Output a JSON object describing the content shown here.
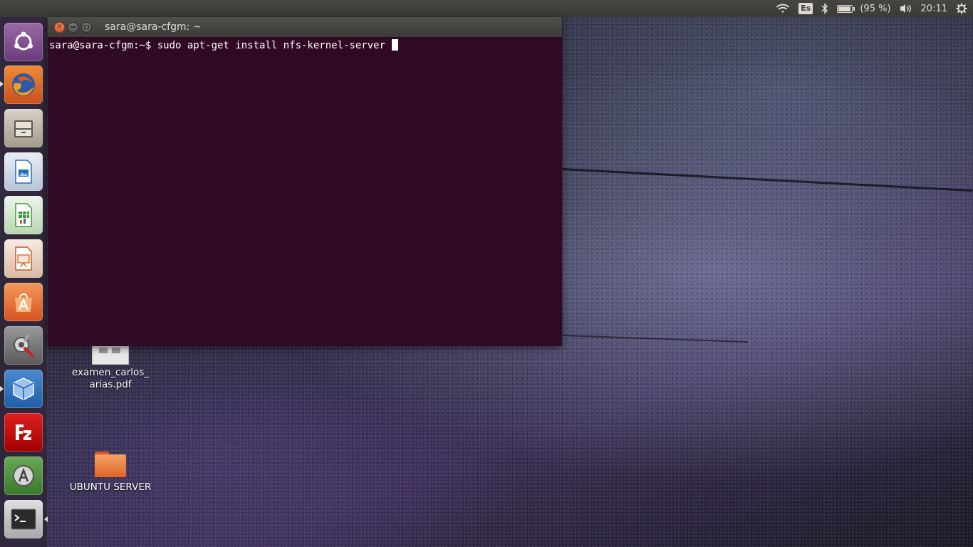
{
  "top_panel": {
    "keyboard_layout": "Es",
    "battery_level": 0.95,
    "battery_text": "(95 %)",
    "clock": "20:11",
    "icons": [
      "wifi-icon",
      "bluetooth-icon",
      "battery-icon",
      "volume-icon",
      "settings-gear-icon"
    ]
  },
  "launcher": {
    "items": [
      {
        "name": "ubuntu-dash-icon",
        "color": "#7a4a8c"
      },
      {
        "name": "firefox-icon",
        "color": "#e66000"
      },
      {
        "name": "files-icon",
        "color": "#8a7d6a"
      },
      {
        "name": "libreoffice-writer-icon",
        "color": "#2a6db0"
      },
      {
        "name": "libreoffice-calc-icon",
        "color": "#3f9a3a"
      },
      {
        "name": "libreoffice-impress-icon",
        "color": "#c85a23"
      },
      {
        "name": "ubuntu-software-center-icon",
        "color": "#e9682a"
      },
      {
        "name": "system-settings-icon",
        "color": "#6a6a6a"
      },
      {
        "name": "virtualbox-icon",
        "color": "#1f5fa6"
      },
      {
        "name": "filezilla-icon",
        "color": "#bf0000"
      },
      {
        "name": "software-updater-icon",
        "color": "#4a8a3a"
      },
      {
        "name": "terminal-icon",
        "color": "#3a3a3a"
      }
    ]
  },
  "terminal": {
    "title": "sara@sara-cfgm: ~",
    "prompt": "sara@sara-cfgm:~$ ",
    "command": "sudo apt-get install nfs-kernel-server "
  },
  "desktop": {
    "icons": [
      {
        "label": "examen_carlos_\narias.pdf",
        "type": "pdf-file-icon"
      },
      {
        "label": "UBUNTU SERVER",
        "type": "folder-icon"
      }
    ]
  }
}
